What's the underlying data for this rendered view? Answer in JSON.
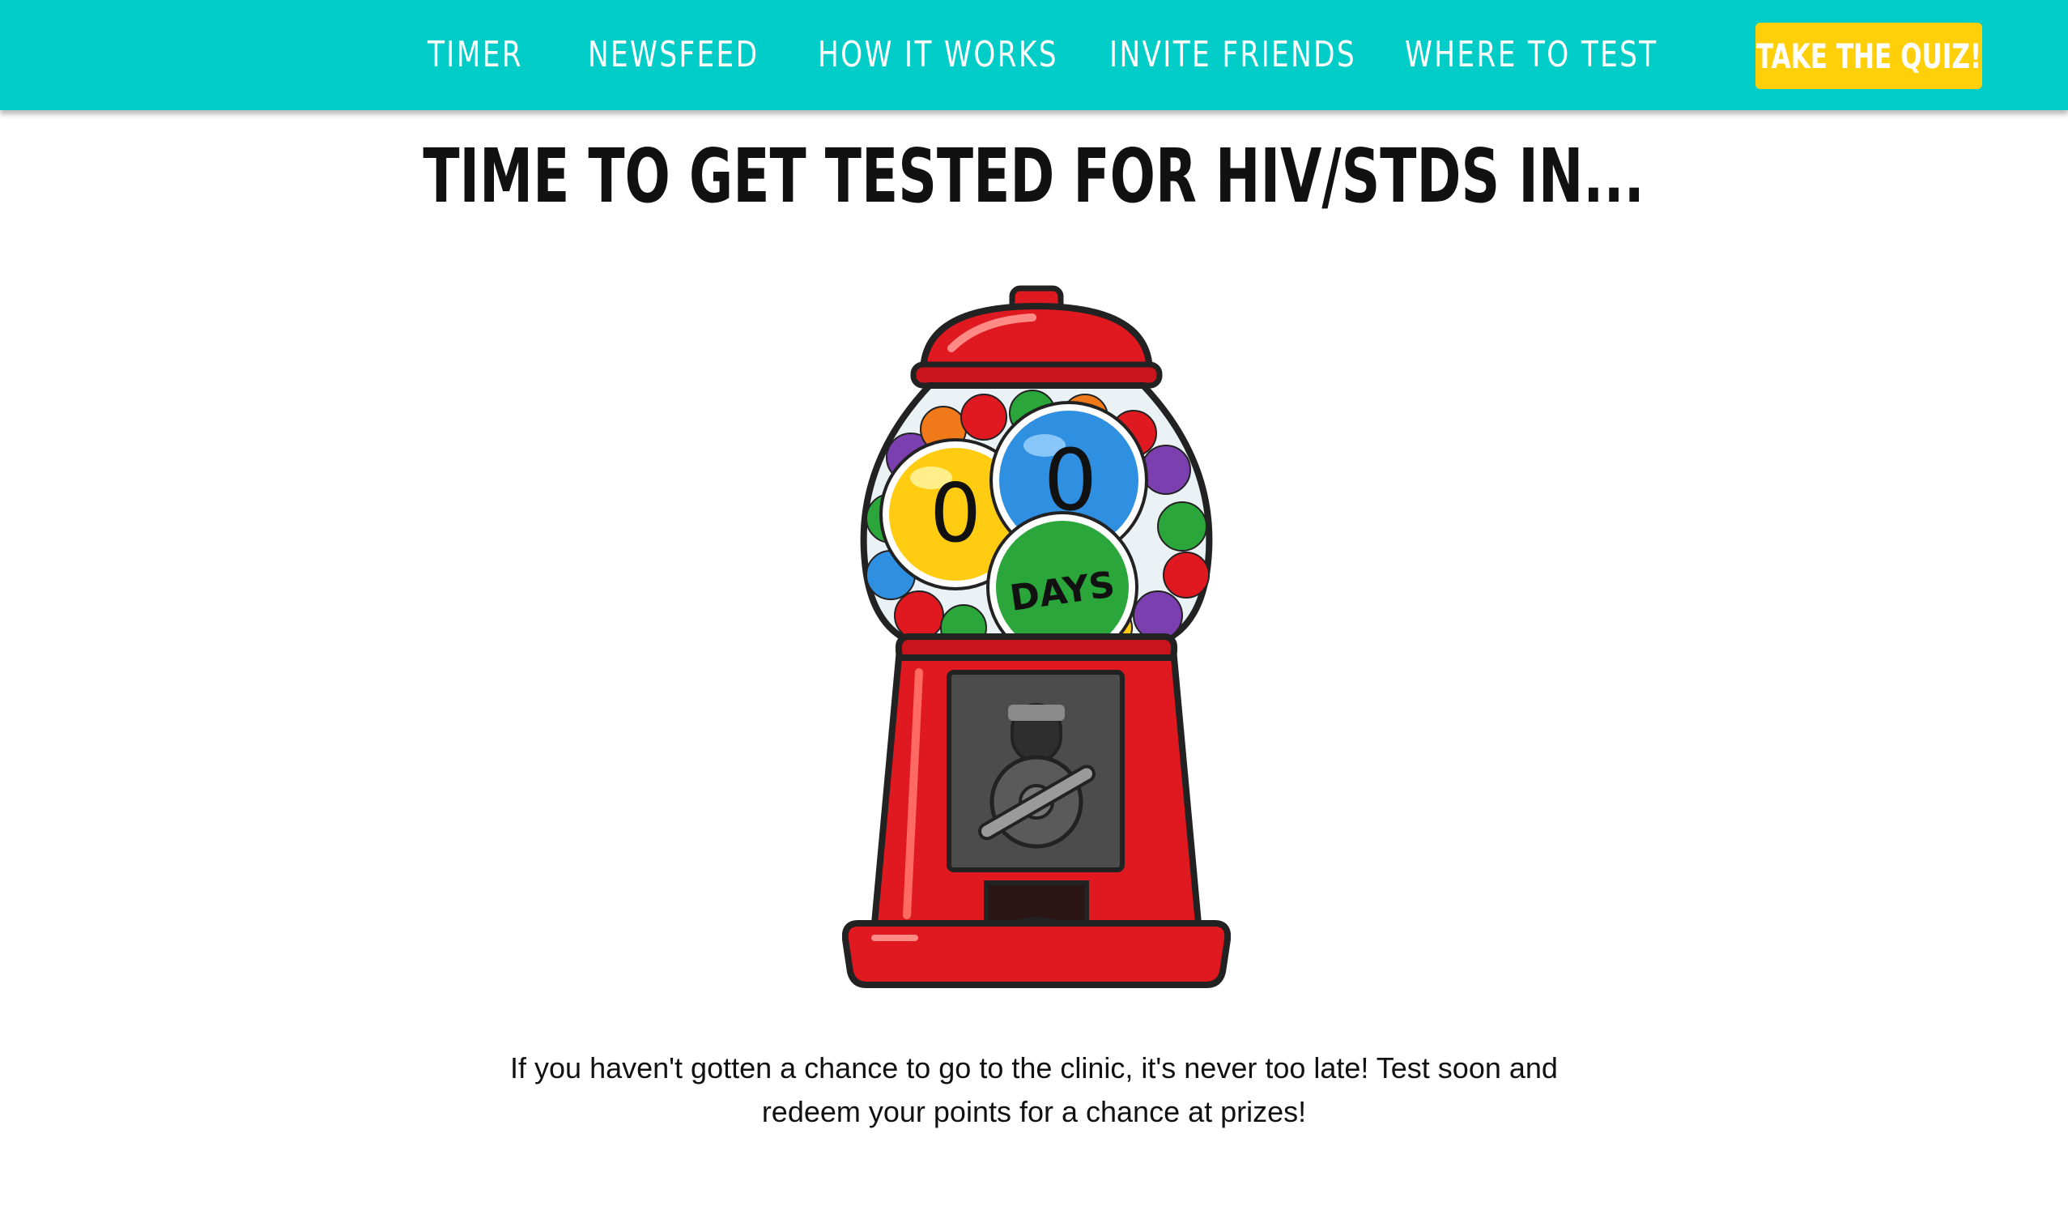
{
  "nav": {
    "items": [
      {
        "label": "TIMER"
      },
      {
        "label": "NEWSFEED"
      },
      {
        "label": "HOW IT WORKS"
      },
      {
        "label": "INVITE FRIENDS"
      },
      {
        "label": "WHERE TO TEST"
      }
    ],
    "quiz_label": "TAKE THE QUIZ!"
  },
  "headline": "TIME TO GET TESTED FOR HIV/STDS IN...",
  "countdown": {
    "digit_1": "0",
    "digit_2": "0",
    "unit": "DAYS"
  },
  "body_text": "If you haven't gotten a chance to go to the clinic, it's never too late! Test soon and redeem your points for a chance at prizes!",
  "colors": {
    "topbar": "#00cdc7",
    "quiz_button": "#ffcf0a",
    "machine_red": "#e01820",
    "gum_yellow": "#ffcc12",
    "gum_blue": "#2f8fe0",
    "gum_green": "#2aa63a"
  },
  "icons": {
    "gumball_machine": "gumball-machine-icon"
  }
}
